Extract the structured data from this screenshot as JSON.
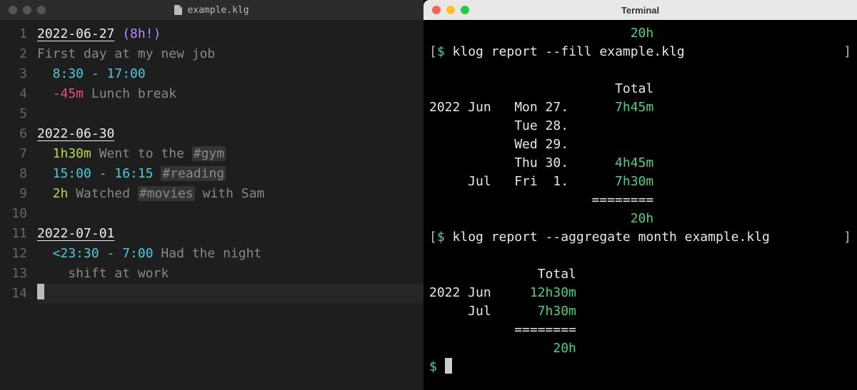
{
  "editor": {
    "title": "example.klg",
    "lines": [
      {
        "n": 1,
        "tokens": [
          {
            "cls": "date",
            "t": "2022-06-27"
          },
          {
            "cls": "",
            "t": " "
          },
          {
            "cls": "should",
            "t": "(8h!)"
          }
        ]
      },
      {
        "n": 2,
        "tokens": [
          {
            "cls": "comment",
            "t": "First day at my new job"
          }
        ]
      },
      {
        "n": 3,
        "indent": 1,
        "tokens": [
          {
            "cls": "time",
            "t": "8:30 - 17:00"
          }
        ]
      },
      {
        "n": 4,
        "indent": 1,
        "tokens": [
          {
            "cls": "neg",
            "t": "-45m"
          },
          {
            "cls": "",
            "t": " "
          },
          {
            "cls": "comment",
            "t": "Lunch break"
          }
        ]
      },
      {
        "n": 5,
        "tokens": []
      },
      {
        "n": 6,
        "tokens": [
          {
            "cls": "date",
            "t": "2022-06-30"
          }
        ]
      },
      {
        "n": 7,
        "indent": 1,
        "tokens": [
          {
            "cls": "dur",
            "t": "1h30m"
          },
          {
            "cls": "",
            "t": " "
          },
          {
            "cls": "comment",
            "t": "Went to the "
          },
          {
            "cls": "tag",
            "t": "#gym"
          }
        ]
      },
      {
        "n": 8,
        "indent": 1,
        "tokens": [
          {
            "cls": "time",
            "t": "15:00 - 16:15"
          },
          {
            "cls": "",
            "t": " "
          },
          {
            "cls": "tag",
            "t": "#reading"
          }
        ]
      },
      {
        "n": 9,
        "indent": 1,
        "tokens": [
          {
            "cls": "dur",
            "t": "2h"
          },
          {
            "cls": "",
            "t": " "
          },
          {
            "cls": "comment",
            "t": "Watched "
          },
          {
            "cls": "tag",
            "t": "#movies"
          },
          {
            "cls": "comment",
            "t": " with Sam"
          }
        ]
      },
      {
        "n": 10,
        "tokens": []
      },
      {
        "n": 11,
        "tokens": [
          {
            "cls": "date",
            "t": "2022-07-01"
          }
        ]
      },
      {
        "n": 12,
        "indent": 1,
        "tokens": [
          {
            "cls": "time",
            "t": "<23:30 - 7:00"
          },
          {
            "cls": "",
            "t": " "
          },
          {
            "cls": "comment",
            "t": "Had the night"
          }
        ]
      },
      {
        "n": 13,
        "indent": 2,
        "tokens": [
          {
            "cls": "comment",
            "t": "shift at work"
          }
        ]
      },
      {
        "n": 14,
        "current": true,
        "cursor": true,
        "tokens": []
      }
    ]
  },
  "terminal": {
    "title": "Terminal",
    "top_total": "20h",
    "cmd1": "klog report --fill example.klg",
    "report1": {
      "header": "Total",
      "rows": [
        {
          "year": "2022",
          "month": "Jun",
          "day": "Mon 27.",
          "value": "7h45m"
        },
        {
          "year": "",
          "month": "",
          "day": "Tue 28.",
          "value": ""
        },
        {
          "year": "",
          "month": "",
          "day": "Wed 29.",
          "value": ""
        },
        {
          "year": "",
          "month": "",
          "day": "Thu 30.",
          "value": "4h45m"
        },
        {
          "year": "",
          "month": "Jul",
          "day": "Fri  1.",
          "value": "7h30m"
        }
      ],
      "rule": "========",
      "grand": "20h"
    },
    "cmd2": "klog report --aggregate month example.klg",
    "report2": {
      "header": "Total",
      "rows": [
        {
          "year": "2022",
          "month": "Jun",
          "value": "12h30m"
        },
        {
          "year": "",
          "month": "Jul",
          "value": "7h30m"
        }
      ],
      "rule": "========",
      "grand": "20h"
    },
    "prompt": "$"
  }
}
